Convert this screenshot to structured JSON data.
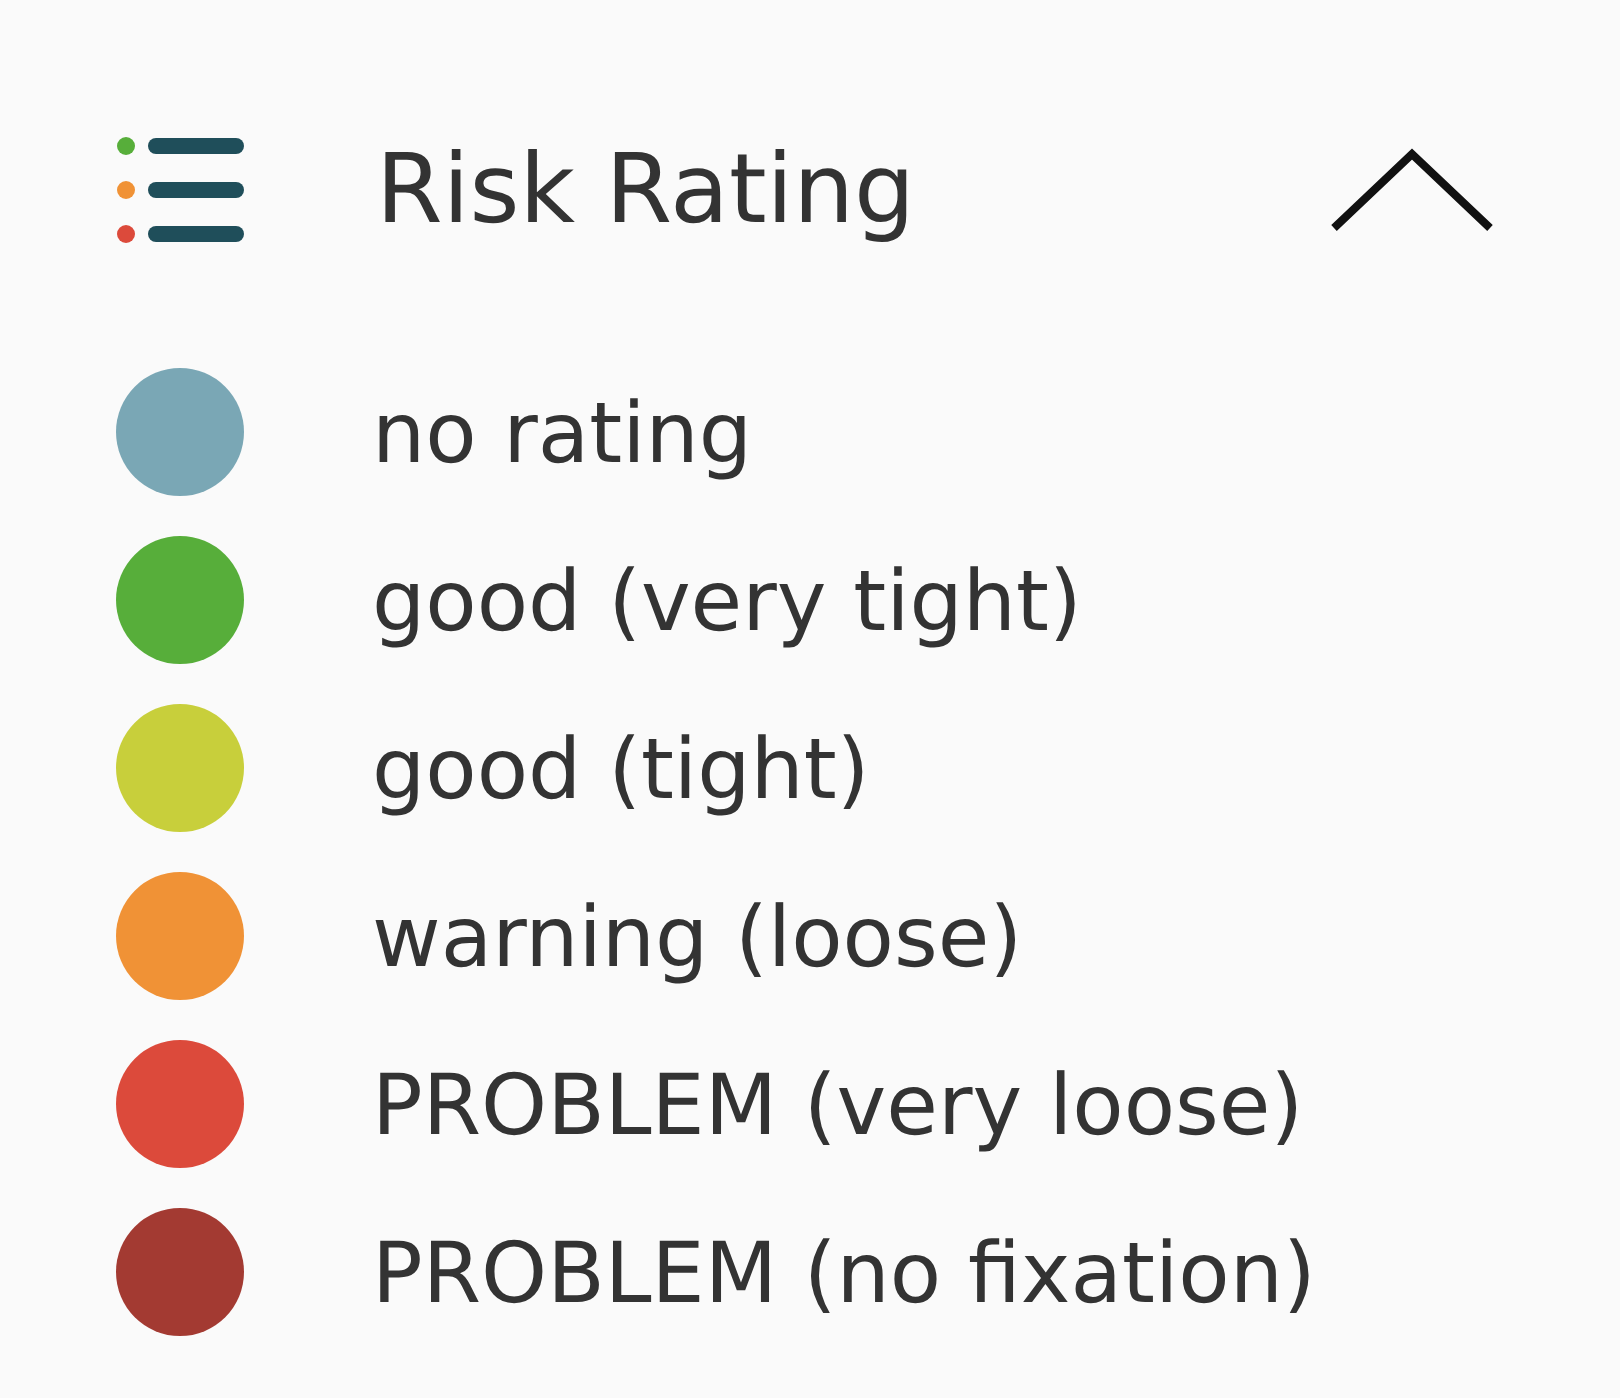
{
  "panel": {
    "title": "Risk Rating",
    "expanded": true,
    "items": [
      {
        "label": "no rating",
        "color": "#7aa7b5"
      },
      {
        "label": "good (very tight)",
        "color": "#57ae3a"
      },
      {
        "label": "good (tight)",
        "color": "#c8cf3b"
      },
      {
        "label": "warning (loose)",
        "color": "#f09236"
      },
      {
        "label": "PROBLEM (very loose)",
        "color": "#dc4a3b"
      },
      {
        "label": "PROBLEM (no fixation)",
        "color": "#a33a32"
      }
    ]
  }
}
